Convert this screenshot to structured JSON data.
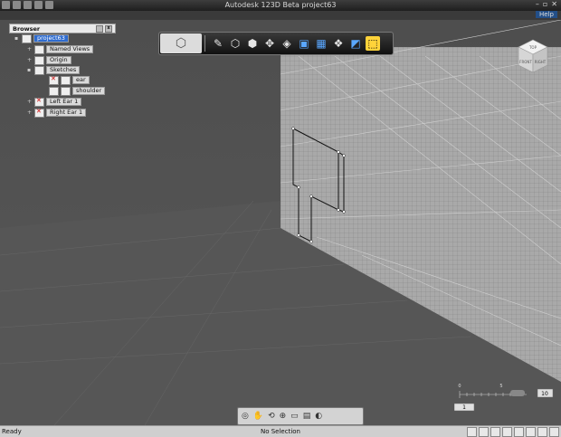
{
  "window": {
    "title": "Autodesk 123D Beta   project63"
  },
  "menu": {
    "help_label": "Help"
  },
  "browser": {
    "title": "Browser",
    "root": "project63",
    "items": [
      {
        "label": "Named Views"
      },
      {
        "label": "Origin"
      },
      {
        "label": "Sketches"
      },
      {
        "label": "ear"
      },
      {
        "label": "shoulder"
      },
      {
        "label": "Left Ear 1"
      },
      {
        "label": "Right Ear 1"
      }
    ]
  },
  "toolbar": {
    "tools": [
      "logo-icon",
      "pencil-icon",
      "box-icon",
      "extrude-icon",
      "move-icon",
      "modify-icon",
      "combine-icon",
      "pattern-icon",
      "group-icon",
      "make-3d-icon",
      "measure-icon"
    ]
  },
  "viewcube": {
    "top": "TOP",
    "front": "FRONT",
    "right": "RIGHT"
  },
  "ruler": {
    "zero_label": "0",
    "five_label": "5",
    "ten_label": "10",
    "scale_value": "10",
    "unit_value": "1"
  },
  "status": {
    "left": "Ready",
    "center": "No Selection"
  },
  "colors": {
    "accent": "#2f6ccf",
    "selected_tool": "#ffd33a"
  }
}
